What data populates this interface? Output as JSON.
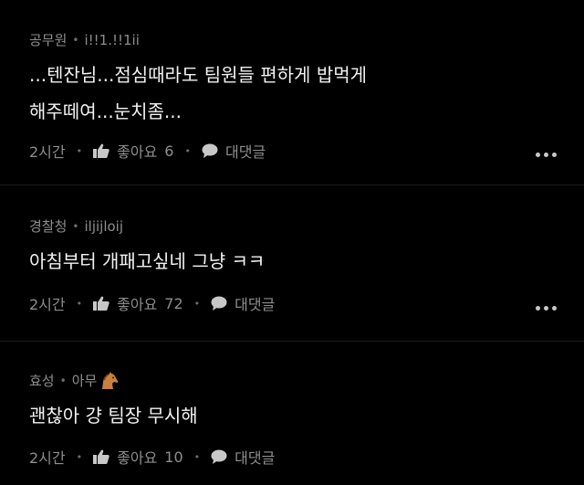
{
  "comments": [
    {
      "author": "공무원",
      "nickname": "i!!1.!!1ii",
      "text": "...텐잔님...점심때라도 팀원들 편하게 밥먹게\n해주떼여...눈치좀...",
      "time": "2시간",
      "like_label": "좋아요",
      "like_count": "6",
      "reply_label": "대댓글"
    },
    {
      "author": "경찰청",
      "nickname": "iljijloij",
      "text": "아침부터 개패고싶네 그냥 ㅋㅋ",
      "time": "2시간",
      "like_label": "좋아요",
      "like_count": "72",
      "reply_label": "대댓글"
    },
    {
      "author": "효성",
      "nickname": "아무",
      "nickname_emoji": "horse",
      "text": "괜찮아 걍 팀장 무시해",
      "time": "2시간",
      "like_label": "좋아요",
      "like_count": "10",
      "reply_label": "대댓글"
    }
  ],
  "colors": {
    "background": "#000000",
    "text": "#f2f2f2",
    "meta": "#8e8e8e"
  },
  "icons": [
    "thumbs-up-icon",
    "speech-bubble-icon",
    "more-options-icon",
    "horse-icon"
  ]
}
